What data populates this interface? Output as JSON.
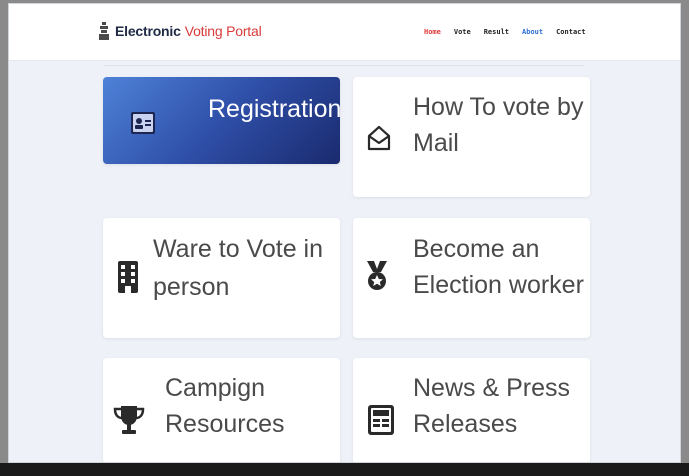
{
  "brand": {
    "first": "Electronic",
    "second": "Voting Portal"
  },
  "nav": {
    "home": "Home",
    "vote": "Vote",
    "result": "Result",
    "about": "About",
    "contact": "Contact"
  },
  "cards": {
    "registration": "Registration",
    "mail_line1": "How To vote by",
    "mail_line2": "Mail",
    "person_line1": "Ware to Vote in",
    "person_line2": "person",
    "worker_line1": "Become an",
    "worker_line2": "Election worker",
    "resources_line1": "Campign",
    "resources_line2": "Resources",
    "news_line1": "News & Press",
    "news_line2": "Releases"
  },
  "colors": {
    "accent_red": "#d93a3a",
    "accent_blue": "#2f6fd6",
    "card_active_start": "#4e82d8",
    "card_active_end": "#1a2a6e"
  }
}
